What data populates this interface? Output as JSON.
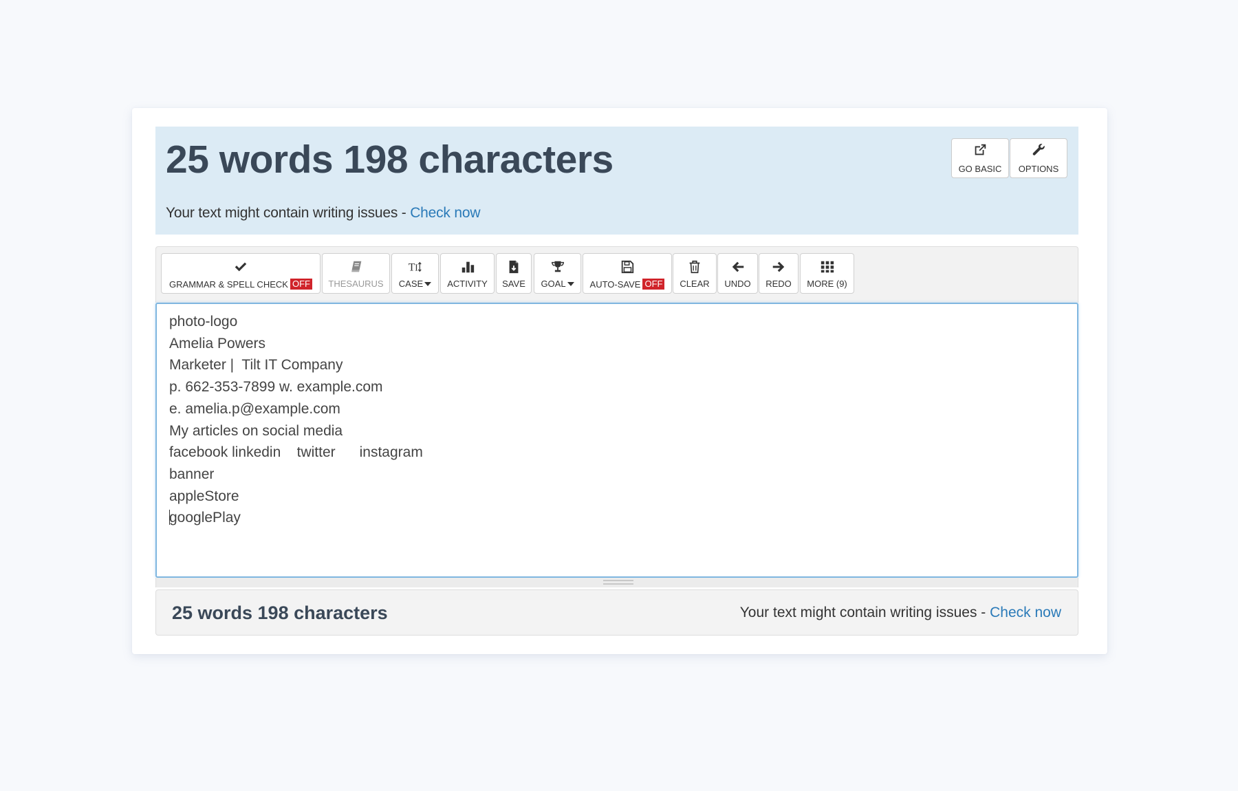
{
  "header": {
    "title": "25 words 198 characters",
    "issues_text": "Your text might contain writing issues - ",
    "check_now": "Check now",
    "buttons": [
      {
        "label": "GO BASIC",
        "icon": "external-link-icon"
      },
      {
        "label": "OPTIONS",
        "icon": "wrench-icon"
      }
    ]
  },
  "toolbar": {
    "grammar": {
      "label": "GRAMMAR & SPELL CHECK",
      "badge": "OFF",
      "icon": "checkmark-icon"
    },
    "thesaurus": {
      "label": "THESAURUS",
      "icon": "book-icon",
      "disabled": true
    },
    "case": {
      "label": "CASE",
      "icon": "text-case-icon",
      "dropdown": true
    },
    "activity": {
      "label": "ACTIVITY",
      "icon": "bar-chart-icon"
    },
    "save": {
      "label": "SAVE",
      "icon": "file-download-icon"
    },
    "goal": {
      "label": "GOAL",
      "icon": "trophy-icon",
      "dropdown": true
    },
    "autosave": {
      "label": "AUTO-SAVE",
      "badge": "OFF",
      "icon": "floppy-disk-icon"
    },
    "clear": {
      "label": "CLEAR",
      "icon": "trash-icon"
    },
    "undo": {
      "label": "UNDO",
      "icon": "arrow-left-icon"
    },
    "redo": {
      "label": "REDO",
      "icon": "arrow-right-icon"
    },
    "more": {
      "label": "MORE (9)",
      "icon": "grid-icon"
    }
  },
  "editor": {
    "lines": [
      "photo-logo",
      "Amelia Powers",
      "Marketer |  Tilt IT Company",
      "p. 662-353-7899 w. example.com",
      "e. amelia.p@example.com",
      "My articles on social media",
      "facebook linkedin    twitter      instagram",
      "banner",
      "appleStore",
      "googlePlay"
    ]
  },
  "footer": {
    "count": "25 words 198 characters",
    "issues_text": "Your text might contain writing issues - ",
    "check_now": "Check now"
  },
  "colors": {
    "header_bg": "#dcebf5",
    "title": "#3a4858",
    "link": "#2a7ab8",
    "off_badge": "#d0242b",
    "editor_border": "#7fb6e0"
  }
}
